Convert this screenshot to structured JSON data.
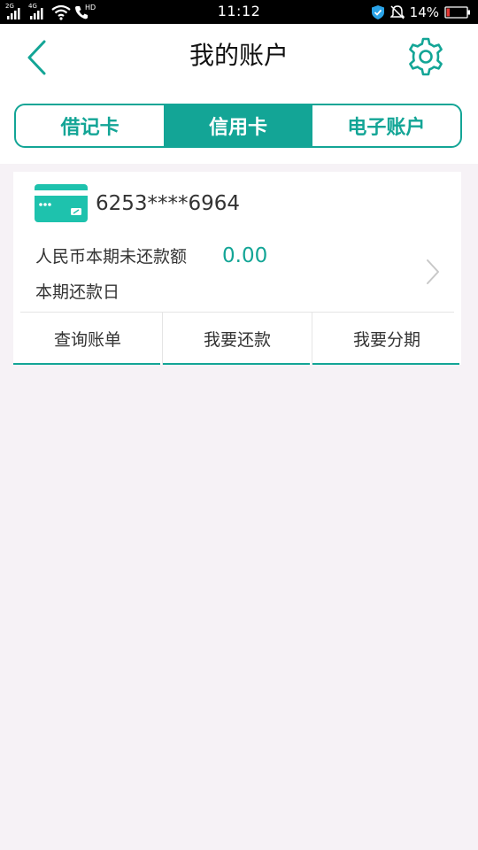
{
  "status_bar": {
    "network1": "2G",
    "network2": "4G",
    "call_badge": "HD",
    "time": "11:12",
    "battery": "14%"
  },
  "header": {
    "title": "我的账户"
  },
  "tabs": [
    {
      "label": "借记卡",
      "active": false
    },
    {
      "label": "信用卡",
      "active": true
    },
    {
      "label": "电子账户",
      "active": false
    }
  ],
  "card": {
    "number": "6253****6964",
    "due_amount_label": "人民币本期未还款额",
    "due_amount": "0.00",
    "due_date_label": "本期还款日",
    "actions": [
      {
        "label": "查询账单"
      },
      {
        "label": "我要还款"
      },
      {
        "label": "我要分期"
      }
    ]
  },
  "colors": {
    "accent": "#13a596",
    "background": "#f6f2f6",
    "status_bar": "#000000",
    "battery_low": "#e53935"
  }
}
